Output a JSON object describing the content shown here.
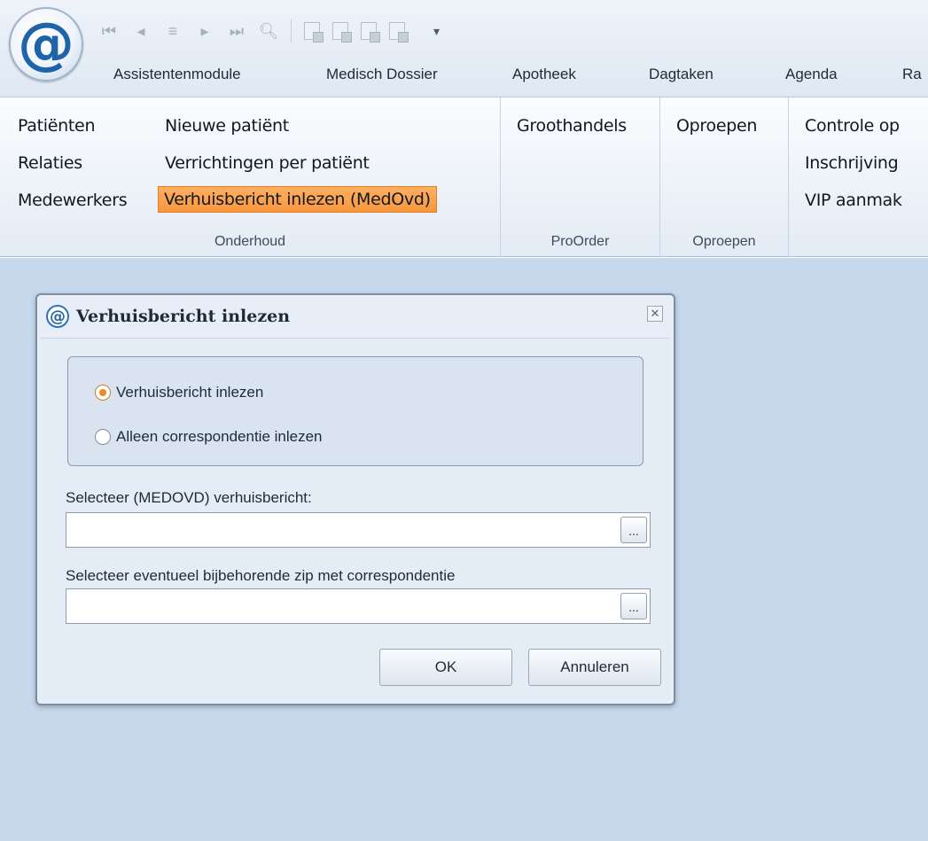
{
  "app": {
    "logo_glyph": "@",
    "logo_icon": "at-sign-icon"
  },
  "quick_access": {
    "icons": [
      "first-record-icon",
      "previous-record-icon",
      "list-icon",
      "next-record-icon",
      "last-record-icon",
      "search-icon",
      "copy-icon",
      "delete-icon",
      "document-icon",
      "print-icon"
    ],
    "more_glyph": "▾"
  },
  "tabs": [
    "Assistentenmodule",
    "Medisch Dossier",
    "Apotheek",
    "Dagtaken",
    "Agenda",
    "Ra"
  ],
  "ribbon": {
    "groups": [
      {
        "label": "Onderhoud",
        "col1": [
          "Patiënten",
          "Relaties",
          "Medewerkers"
        ],
        "col2": [
          "Nieuwe patiënt",
          "Verrichtingen per patiënt",
          "Verhuisbericht inlezen (MedOvd)"
        ]
      },
      {
        "label": "ProOrder",
        "items": [
          "Groothandels"
        ]
      },
      {
        "label": "Oproepen",
        "items": [
          "Oproepen"
        ]
      },
      {
        "label": "",
        "items": [
          "Controle op",
          "Inschrijving",
          "VIP aanmak"
        ]
      }
    ]
  },
  "dialog": {
    "title": "Verhuisbericht inlezen",
    "close_glyph": "✕",
    "options": [
      {
        "label": "Verhuisbericht inlezen",
        "checked": true
      },
      {
        "label": "Alleen correspondentie inlezen",
        "checked": false
      }
    ],
    "field1_label": "Selecteer (MEDOVD) verhuisbericht:",
    "field1_value": "",
    "field2_label": "Selecteer eventueel bijbehorende zip met correspondentie",
    "field2_value": "",
    "browse_label": "...",
    "ok_label": "OK",
    "cancel_label": "Annuleren"
  },
  "colors": {
    "accent_orange": "#f7963c",
    "brand_blue": "#1f63a8",
    "workspace": "#c6d8ec"
  }
}
